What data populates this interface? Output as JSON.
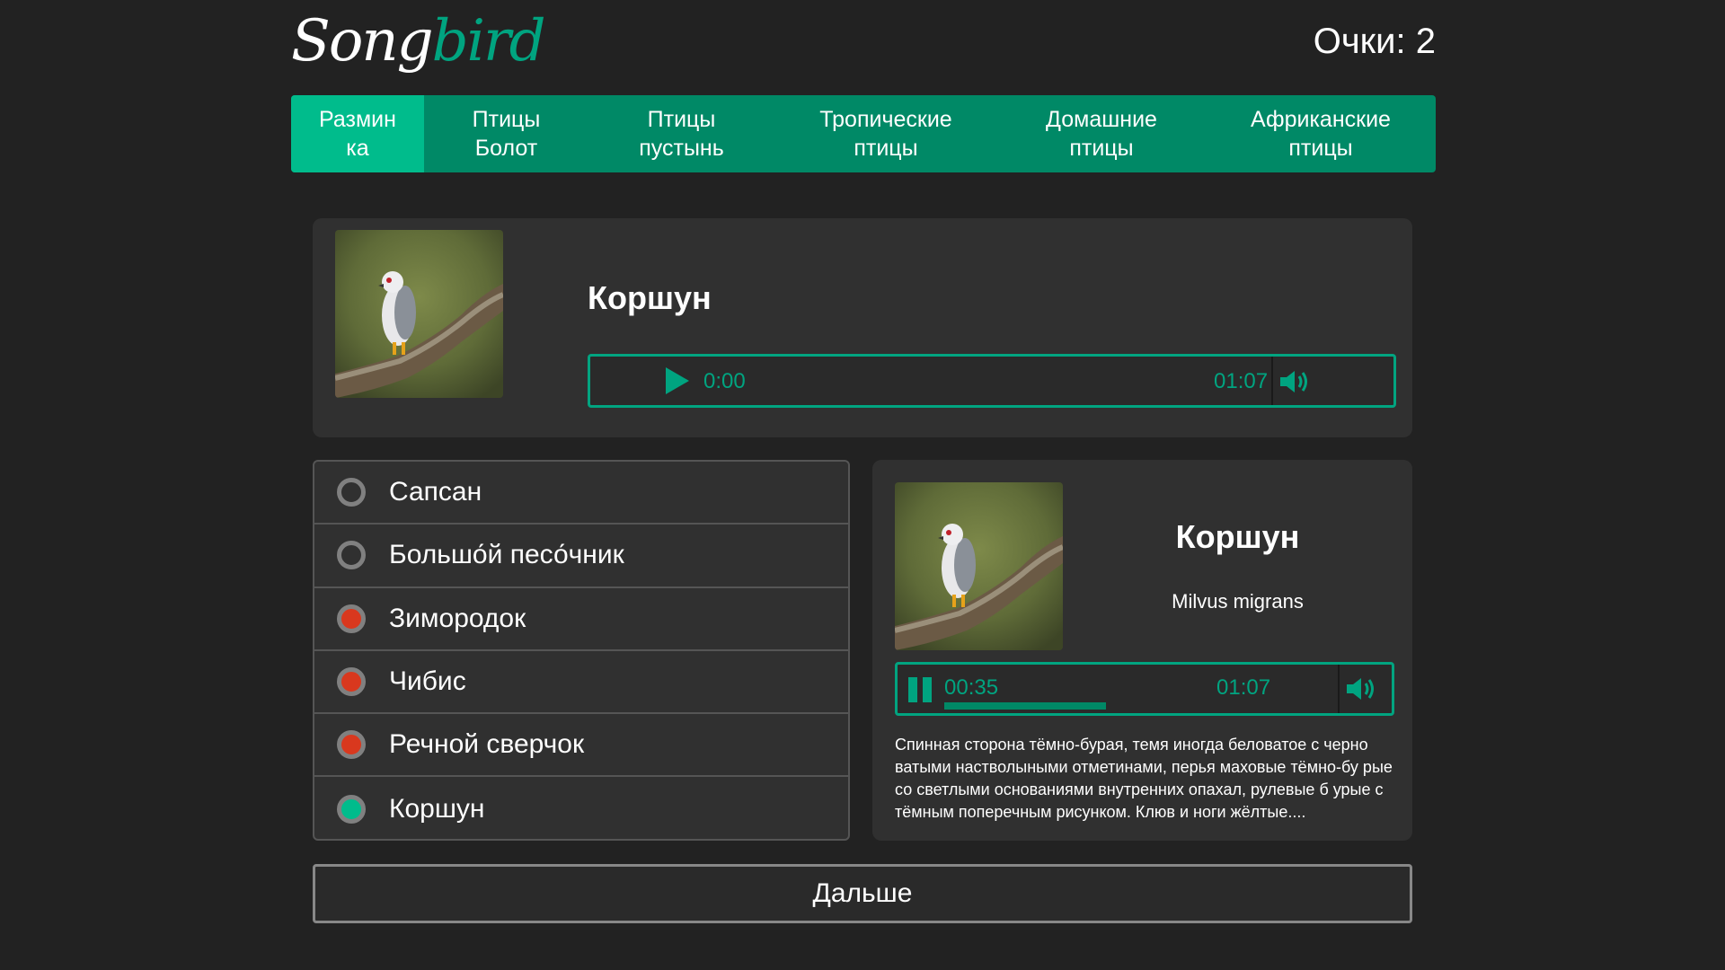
{
  "header": {
    "logo_part1": "Song",
    "logo_part2": "bird",
    "score": "Очки: 2"
  },
  "nav": {
    "items": [
      {
        "line1": "Размин",
        "line2": "ка",
        "active": true
      },
      {
        "line1": "Птицы",
        "line2": "Болот",
        "active": false
      },
      {
        "line1": "Птицы",
        "line2": "пустынь",
        "active": false
      },
      {
        "line1": "Тропические",
        "line2": "птицы",
        "active": false
      },
      {
        "line1": "Домашние",
        "line2": "птицы",
        "active": false
      },
      {
        "line1": "Африканские",
        "line2": "птицы",
        "active": false
      }
    ]
  },
  "question": {
    "bird_name": "Коршун",
    "player": {
      "current_time": "0:00",
      "duration": "01:07",
      "state": "paused"
    }
  },
  "answers": [
    {
      "label": "Сапсан",
      "state": "neutral"
    },
    {
      "label": "Большо́й песо́чник",
      "state": "neutral"
    },
    {
      "label": "Зимородок",
      "state": "wrong"
    },
    {
      "label": "Чибис",
      "state": "wrong"
    },
    {
      "label": "Речной сверчок",
      "state": "wrong"
    },
    {
      "label": "Коршун",
      "state": "correct"
    }
  ],
  "details": {
    "bird_name": "Коршун",
    "latin_name": "Milvus migrans",
    "player": {
      "current_time": "00:35",
      "duration": "01:07",
      "state": "playing",
      "progress": 0.52
    },
    "description": "Спинная сторона тёмно-бурая, темя иногда беловатое с черно ватыми настволыными отметинами, перья маховые тёмно-бу рые со светлыми основаниями внутренних опахал, рулевые б урые с тёмным поперечным рисунком. Клюв и ноги жёлтые...."
  },
  "next_button": {
    "label": "Дальше"
  },
  "colors": {
    "accent": "#00a480",
    "nav_bg": "#008966",
    "nav_active": "#00bc8c",
    "wrong": "#d9381e",
    "correct": "#00bc8c",
    "bg": "#222222",
    "panel": "#303030"
  },
  "icons": {
    "play": "play-icon",
    "pause": "pause-icon",
    "volume": "volume-icon"
  }
}
